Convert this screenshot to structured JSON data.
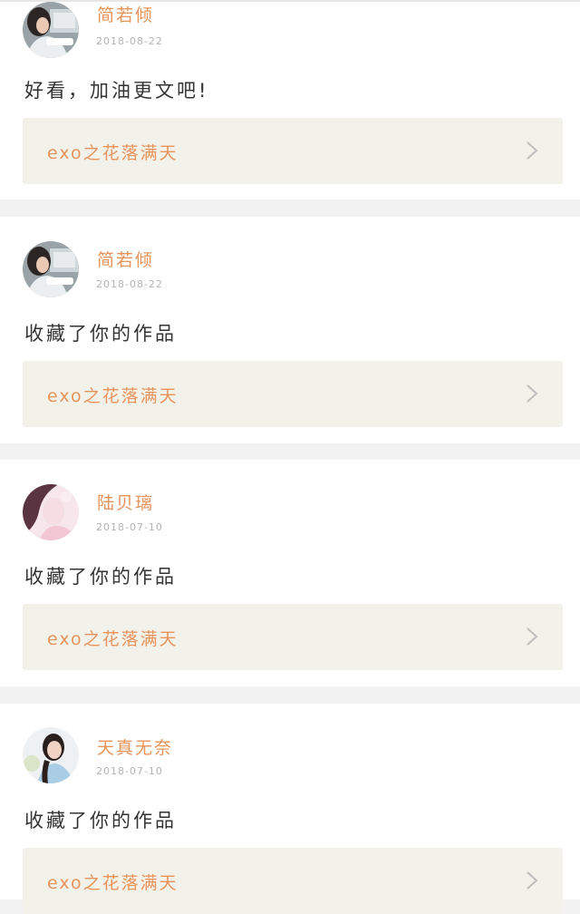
{
  "comments": [
    {
      "username": "简若倾",
      "date": "2018-08-22",
      "content": "好看，加油更文吧!",
      "work_title": "exo之花落满天",
      "avatar": "girl-photo-icon"
    },
    {
      "username": "简若倾",
      "date": "2018-08-22",
      "content": "收藏了你的作品",
      "work_title": "exo之花落满天",
      "avatar": "girl-photo-icon"
    },
    {
      "username": "陆贝璃",
      "date": "2018-07-10",
      "content": "收藏了你的作品",
      "work_title": "exo之花落满天",
      "avatar": "pink-portrait-icon"
    },
    {
      "username": "天真无奈",
      "date": "2018-07-10",
      "content": "收藏了你的作品",
      "work_title": "exo之花落满天",
      "avatar": "portrait-icon"
    }
  ],
  "colors": {
    "accent": "#e8935a",
    "link_background": "#f3f2ea",
    "separator": "#f2f2f2",
    "date_text": "#b3b3b3",
    "body_text": "#333333"
  }
}
